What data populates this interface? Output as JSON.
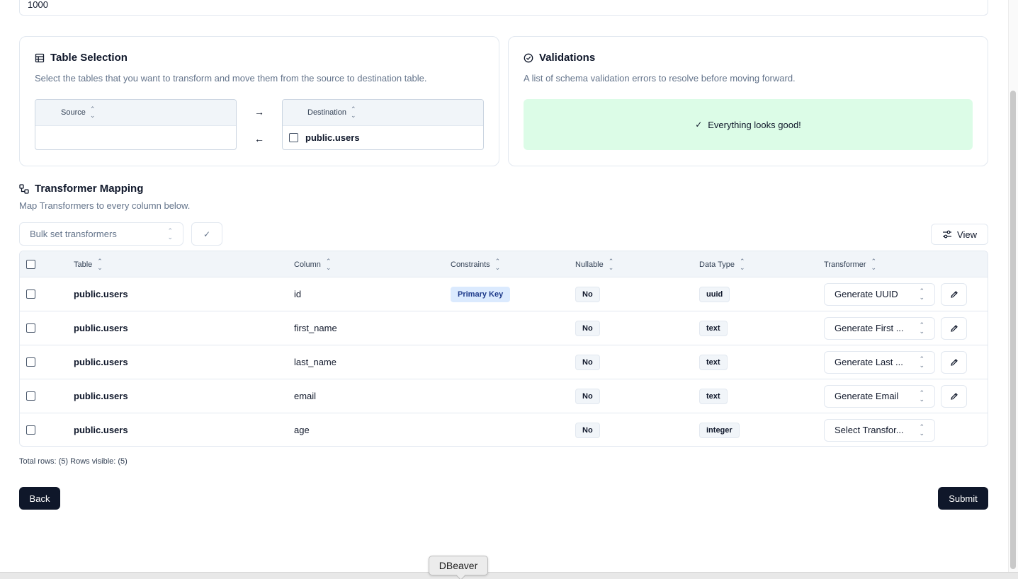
{
  "top_field": {
    "value": "1000"
  },
  "table_selection": {
    "title": "Table Selection",
    "subtitle": "Select the tables that you want to transform and move them from the source to destination table.",
    "source_header": "Source",
    "destination_header": "Destination",
    "destination_items": [
      "public.users"
    ],
    "arrow_right": "→",
    "arrow_left": "←"
  },
  "validations": {
    "title": "Validations",
    "subtitle": "A list of schema validation errors to resolve before moving forward.",
    "status": "Everything looks good!",
    "status_color": "#dcfce7"
  },
  "transformer_mapping": {
    "title": "Transformer Mapping",
    "subtitle": "Map Transformers to every column below.",
    "bulk_placeholder": "Bulk set transformers",
    "view_label": "View",
    "columns": {
      "table": "Table",
      "column": "Column",
      "constraints": "Constraints",
      "nullable": "Nullable",
      "data_type": "Data Type",
      "transformer": "Transformer"
    },
    "rows": [
      {
        "table": "public.users",
        "column": "id",
        "constraint": "Primary Key",
        "nullable": "No",
        "data_type": "uuid",
        "transformer": "Generate UUID",
        "editable": true
      },
      {
        "table": "public.users",
        "column": "first_name",
        "constraint": "",
        "nullable": "No",
        "data_type": "text",
        "transformer": "Generate First ...",
        "editable": true
      },
      {
        "table": "public.users",
        "column": "last_name",
        "constraint": "",
        "nullable": "No",
        "data_type": "text",
        "transformer": "Generate Last ...",
        "editable": true
      },
      {
        "table": "public.users",
        "column": "email",
        "constraint": "",
        "nullable": "No",
        "data_type": "text",
        "transformer": "Generate Email",
        "editable": true
      },
      {
        "table": "public.users",
        "column": "age",
        "constraint": "",
        "nullable": "No",
        "data_type": "integer",
        "transformer": "Select Transfor...",
        "editable": false
      }
    ],
    "footer": "Total rows: (5) Rows visible: (5)"
  },
  "actions": {
    "back": "Back",
    "submit": "Submit"
  },
  "tooltip": {
    "label": "DBeaver"
  },
  "colors": {
    "primary_button": "#0f172a",
    "pk_badge": "#dbeafe"
  }
}
